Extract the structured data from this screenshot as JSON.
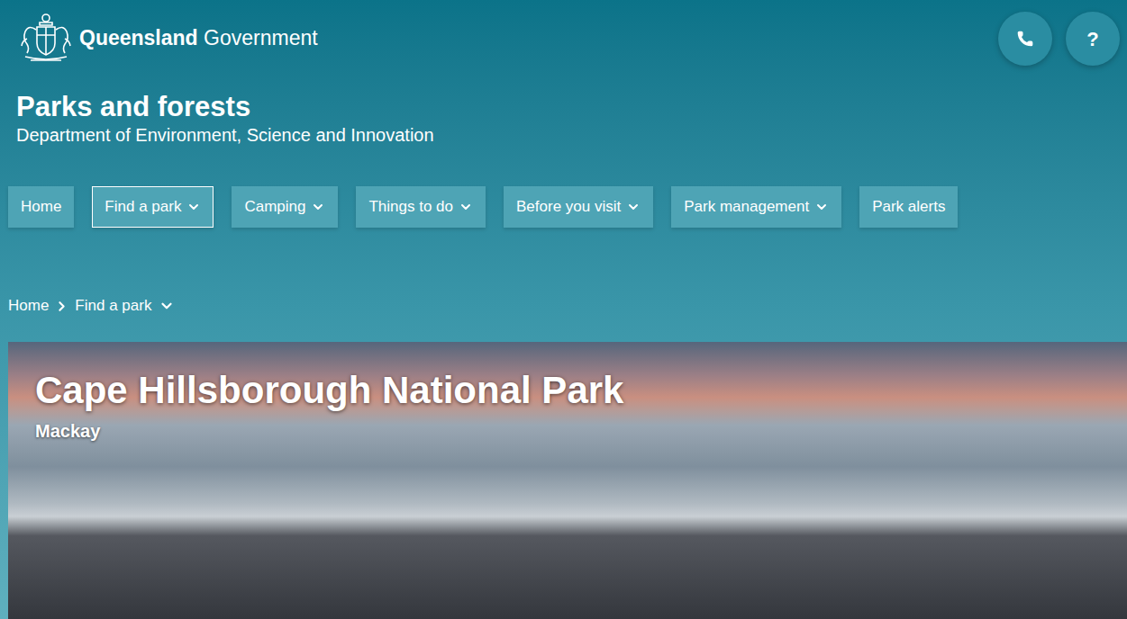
{
  "header": {
    "brand_bold": "Queensland",
    "brand_rest": "Government",
    "help_button": "?"
  },
  "site": {
    "title": "Parks and forests",
    "subtitle": "Department of Environment, Science and Innovation"
  },
  "nav": [
    {
      "label": "Home",
      "selected": false,
      "dropdown": false
    },
    {
      "label": "Find a park",
      "selected": true,
      "dropdown": true
    },
    {
      "label": "Camping",
      "selected": false,
      "dropdown": true
    },
    {
      "label": "Things to do",
      "selected": false,
      "dropdown": true
    },
    {
      "label": "Before you visit",
      "selected": false,
      "dropdown": true
    },
    {
      "label": "Park management",
      "selected": false,
      "dropdown": true
    },
    {
      "label": "Park alerts",
      "selected": false,
      "dropdown": false
    }
  ],
  "breadcrumb": [
    {
      "label": "Home",
      "dropdown": false
    },
    {
      "label": "Find a park",
      "dropdown": true
    }
  ],
  "hero": {
    "title": "Cape Hillsborough National Park",
    "location": "Mackay"
  }
}
